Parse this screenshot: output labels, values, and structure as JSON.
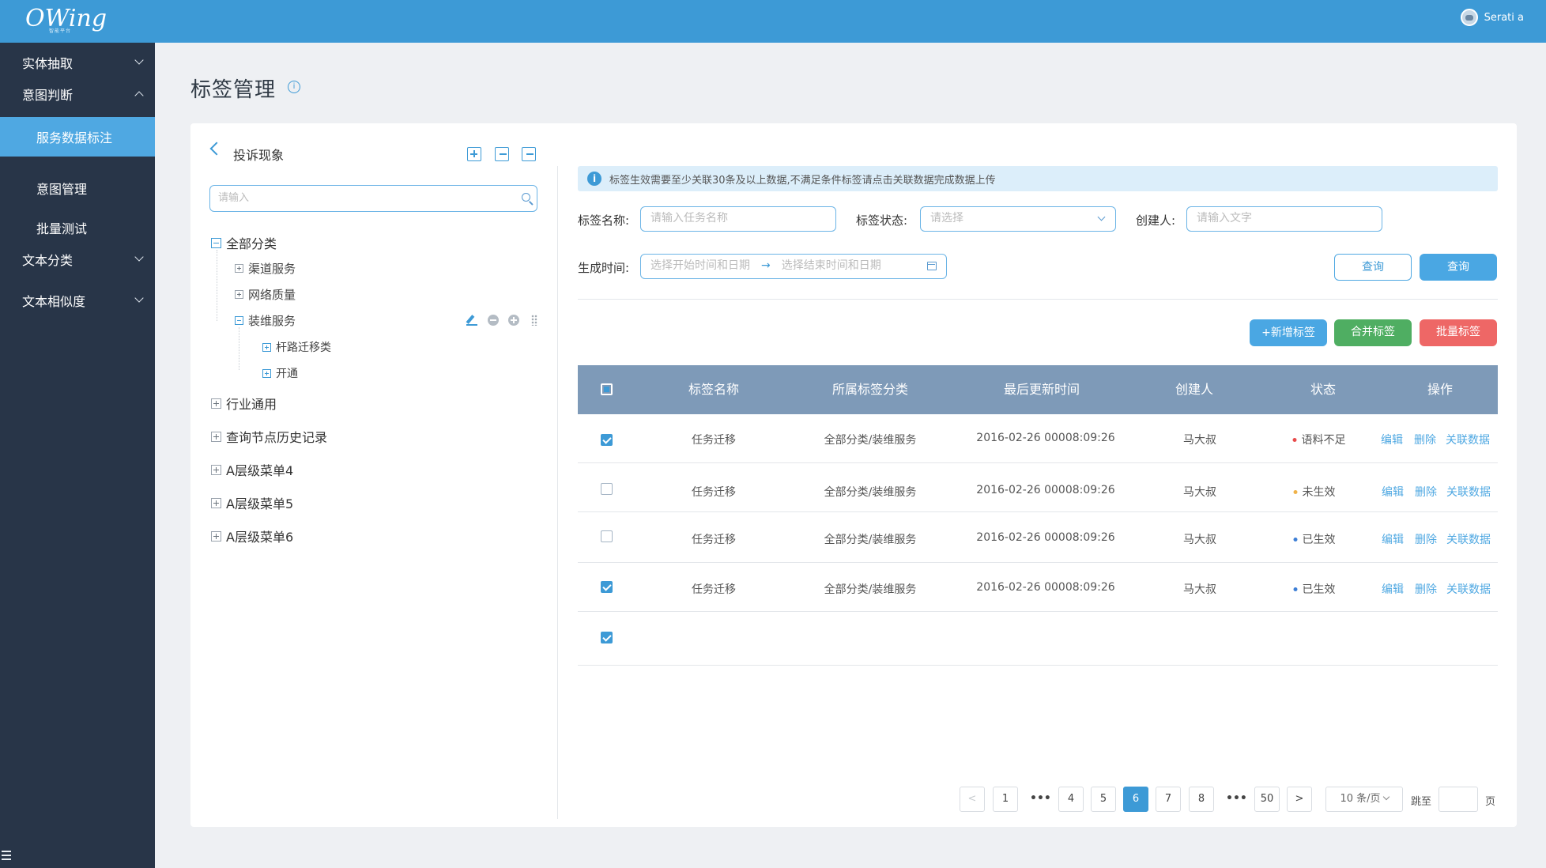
{
  "topbar": {
    "logo": "OWing",
    "logo_sub": "智能平台",
    "user": "Serati a"
  },
  "sidebar": {
    "items": [
      {
        "label": "实体抽取",
        "expanded": false
      },
      {
        "label": "意图判断",
        "expanded": true
      },
      {
        "label": "服务数据标注",
        "active": true
      },
      {
        "label": "意图管理"
      },
      {
        "label": "批量测试"
      },
      {
        "label": "文本分类",
        "expanded": false
      },
      {
        "label": "文本相似度",
        "expanded": false
      }
    ]
  },
  "page": {
    "title": "标签管理",
    "info_icon": "i"
  },
  "tree": {
    "title": "投诉现象",
    "search_placeholder": "请输入",
    "nodes": [
      {
        "label": "全部分类"
      },
      {
        "label": "渠道服务"
      },
      {
        "label": "网络质量"
      },
      {
        "label": "装维服务"
      },
      {
        "label": "杆路迁移类"
      },
      {
        "label": "开通"
      },
      {
        "label": "行业通用"
      },
      {
        "label": "查询节点历史记录"
      },
      {
        "label": "A层级菜单4"
      },
      {
        "label": "A层级菜单5"
      },
      {
        "label": "A层级菜单6"
      }
    ]
  },
  "alert": {
    "icon": "i",
    "text": "标签生效需要至少关联30条及以上数据,不满足条件标签请点击关联数据完成数据上传"
  },
  "filters": {
    "name_label": "标签名称:",
    "name_placeholder": "请输入任务名称",
    "status_label": "标签状态:",
    "status_placeholder": "请选择",
    "creator_label": "创建人:",
    "creator_placeholder": "请输入文字",
    "time_label": "生成时间:",
    "time_start": "选择开始时间和日期",
    "time_arrow": "→",
    "time_end": "选择结束时间和日期",
    "btn_query_outline": "查询",
    "btn_query": "查询"
  },
  "actions": {
    "add": "+新增标签",
    "merge": "合并标签",
    "batch": "批量标签"
  },
  "table": {
    "headers": [
      "标签名称",
      "所属标签分类",
      "最后更新时间",
      "创建人",
      "状态",
      "操作"
    ],
    "rows": [
      {
        "checked": true,
        "name": "任务迁移",
        "category": "全部分类/装维服务",
        "time": "2016-02-26 00008:09:26",
        "creator": "马大叔",
        "status": "语料不足",
        "status_color": "#e84c4c"
      },
      {
        "checked": false,
        "name": "任务迁移",
        "category": "全部分类/装维服务",
        "time": "2016-02-26 00008:09:26",
        "creator": "马大叔",
        "status": "未生效",
        "status_color": "#f0b34a"
      },
      {
        "checked": false,
        "name": "任务迁移",
        "category": "全部分类/装维服务",
        "time": "2016-02-26 00008:09:26",
        "creator": "马大叔",
        "status": "已生效",
        "status_color": "#3d7fd6"
      },
      {
        "checked": true,
        "name": "任务迁移",
        "category": "全部分类/装维服务",
        "time": "2016-02-26 00008:09:26",
        "creator": "马大叔",
        "status": "已生效",
        "status_color": "#3d7fd6"
      },
      {
        "checked": true
      }
    ],
    "ops": {
      "edit": "编辑",
      "delete": "删除",
      "link": "关联数据"
    }
  },
  "pagination": {
    "prev": "<",
    "next": ">",
    "dots": "•••",
    "pages": [
      "1",
      "4",
      "5",
      "6",
      "7",
      "8",
      "50"
    ],
    "current": "6",
    "page_size": "10 条/页",
    "jump_label": "跳至",
    "page_suffix": "页"
  },
  "colors": {
    "primary": "#3d9ad6",
    "sidebar": "#283548",
    "table_header": "#7e9ab8",
    "green": "#4fae62",
    "red": "#ee6766"
  }
}
